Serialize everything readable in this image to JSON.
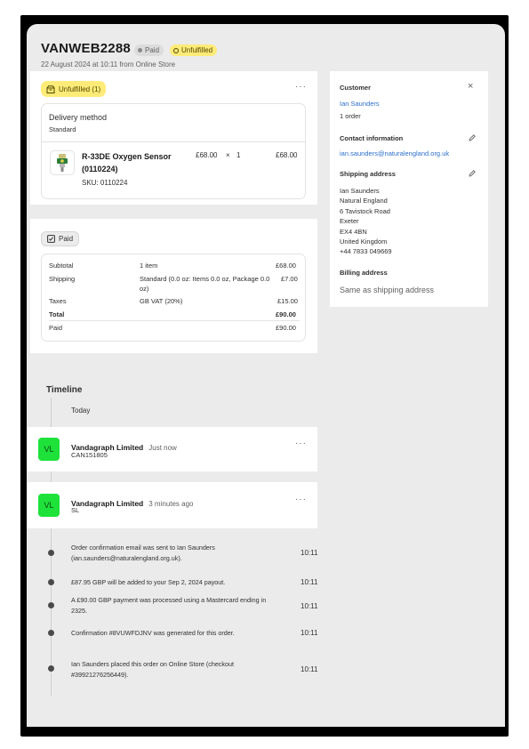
{
  "order": {
    "number": "VANWEB2288",
    "paid_badge": "Paid",
    "unfulfilled_badge": "Unfulfilled",
    "subtitle": "22 August 2024 at 10:11 from Online Store"
  },
  "fulfillment": {
    "status_label": "Unfulfilled (1)",
    "more": "···",
    "delivery_method_label": "Delivery method",
    "delivery_method_value": "Standard",
    "item": {
      "name": "R-33DE Oxygen Sensor (0110224)",
      "sku": "SKU: 0110224",
      "price": "£68.00",
      "times": "×",
      "qty": "1",
      "total": "£68.00"
    }
  },
  "payment": {
    "status_label": "Paid",
    "rows": {
      "subtotal": {
        "label": "Subtotal",
        "desc": "1 item",
        "amount": "£68.00"
      },
      "shipping": {
        "label": "Shipping",
        "desc": "Standard (0.0 oz: Items 0.0 oz, Package 0.0 oz)",
        "amount": "£7.00"
      },
      "taxes": {
        "label": "Taxes",
        "desc": "GB VAT (20%)",
        "amount": "£15.00"
      },
      "total": {
        "label": "Total",
        "amount": "£90.00"
      },
      "paid": {
        "label": "Paid",
        "amount": "£90.00"
      }
    }
  },
  "customer": {
    "heading": "Customer",
    "close": "×",
    "name": "Ian Saunders",
    "orders": "1 order",
    "contact_heading": "Contact information",
    "email": "ian.saunders@naturalengland.org.uk",
    "shipping_heading": "Shipping address",
    "shipping_lines": [
      "Ian Saunders",
      "Natural England",
      "6 Tavistock Road",
      "Exeter",
      "EX4 4BN",
      "United Kingdom",
      "+44 7833 049669"
    ],
    "billing_heading": "Billing address",
    "billing_value": "Same as shipping address"
  },
  "timeline": {
    "title": "Timeline",
    "today": "Today",
    "comments": [
      {
        "initials": "VL",
        "name": "Vandagraph Limited",
        "time": "Just now",
        "text": "CAN151805",
        "more": "···"
      },
      {
        "initials": "VL",
        "name": "Vandagraph Limited",
        "time": "3 minutes ago",
        "text": "SL",
        "more": "···"
      }
    ],
    "events": [
      {
        "text": "Order confirmation email was sent to Ian Saunders (ian.saunders@naturalengland.org.uk).",
        "time": "10:11"
      },
      {
        "text": "£87.95 GBP will be added to your Sep 2, 2024 payout.",
        "time": "10:11"
      },
      {
        "text": "A £90.00 GBP payment was processed using a Mastercard ending in 2325.",
        "time": "10:11"
      },
      {
        "text": "Confirmation #8VUWFDJNV was generated for this order.",
        "time": "10:11"
      },
      {
        "text": "Ian Saunders placed this order on Online Store (checkout #39921276256449).",
        "time": "10:11"
      }
    ]
  },
  "colors": {
    "unfulfilled_bg": "#ffeb78",
    "avatar_bg": "#1ee23a",
    "page_bg": "#ebebeb"
  },
  "icons": [
    "box-icon",
    "receipt-check-icon",
    "more-icon",
    "close-icon",
    "pencil-icon",
    "product-thumbnail"
  ]
}
